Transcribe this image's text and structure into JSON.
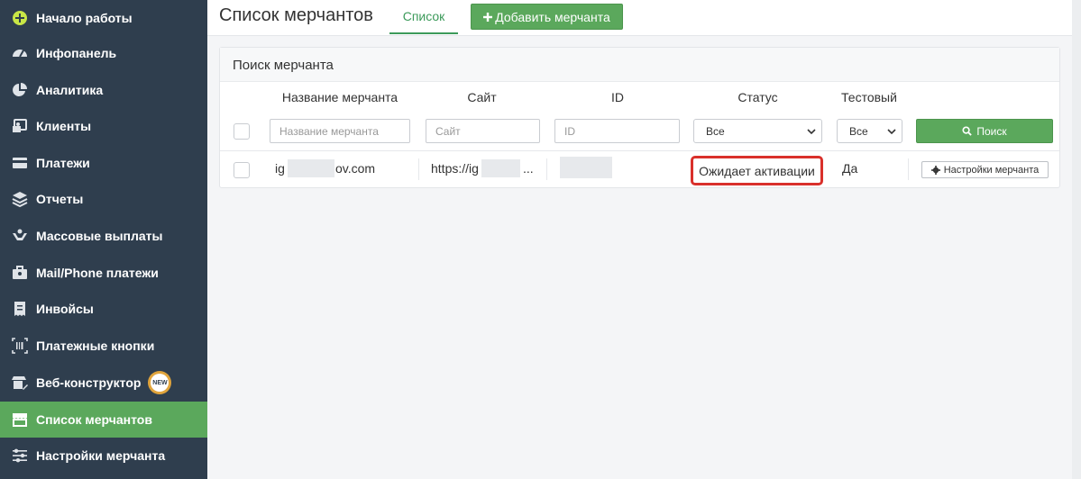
{
  "sidebar": {
    "items": [
      {
        "label": "Начало работы",
        "icon": "plus-circle-icon"
      },
      {
        "label": "Инфопанель",
        "icon": "gauge-icon"
      },
      {
        "label": "Аналитика",
        "icon": "pie-chart-icon"
      },
      {
        "label": "Клиенты",
        "icon": "id-card-icon"
      },
      {
        "label": "Платежи",
        "icon": "credit-card-icon"
      },
      {
        "label": "Отчеты",
        "icon": "layers-icon"
      },
      {
        "label": "Массовые выплаты",
        "icon": "hand-coins-icon"
      },
      {
        "label": "Mail/Phone платежи",
        "icon": "briefcase-icon"
      },
      {
        "label": "Инвойсы",
        "icon": "receipt-icon"
      },
      {
        "label": "Платежные кнопки",
        "icon": "barcode-icon"
      },
      {
        "label": "Веб-конструктор",
        "icon": "store-edit-icon",
        "badge": "NEW"
      },
      {
        "label": "Список мерчантов",
        "icon": "storefront-icon",
        "active": true
      },
      {
        "label": "Настройки мерчанта",
        "icon": "sliders-icon"
      }
    ]
  },
  "header": {
    "title": "Список мерчантов",
    "tab_label": "Список",
    "add_button": "Добавить мерчанта"
  },
  "search_panel": {
    "title": "Поиск мерчанта",
    "columns": [
      "Название мерчанта",
      "Сайт",
      "ID",
      "Статус",
      "Тестовый"
    ],
    "filters": {
      "name_placeholder": "Название мерчанта",
      "site_placeholder": "Сайт",
      "id_placeholder": "ID",
      "status_value": "Все",
      "test_value": "Все"
    },
    "search_button": "Поиск"
  },
  "rows": [
    {
      "name_start": "ig",
      "name_end": "ov.com",
      "site": "https://ig",
      "site_end": "...",
      "status": "Ожидает активации",
      "test": "Да",
      "settings_button": "Настройки мерчанта"
    }
  ],
  "colors": {
    "sidebar_bg": "#2f3e4e",
    "accent_green": "#5ba85c",
    "tab_green": "#3c9a5a",
    "highlight_red": "#d9302b"
  }
}
